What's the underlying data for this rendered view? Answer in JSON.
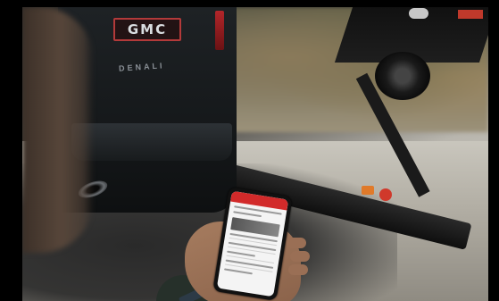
{
  "photo": {
    "description": "",
    "truck_logo_text": "GMC",
    "truck_model_text": "DENALI"
  },
  "colors": {
    "app_header": "#d22a2a",
    "truck_paint": "#1e2225",
    "brand_red": "#c0392b"
  },
  "icons": {
    "phone": "smartphone",
    "wheel": "spare-wheel"
  }
}
